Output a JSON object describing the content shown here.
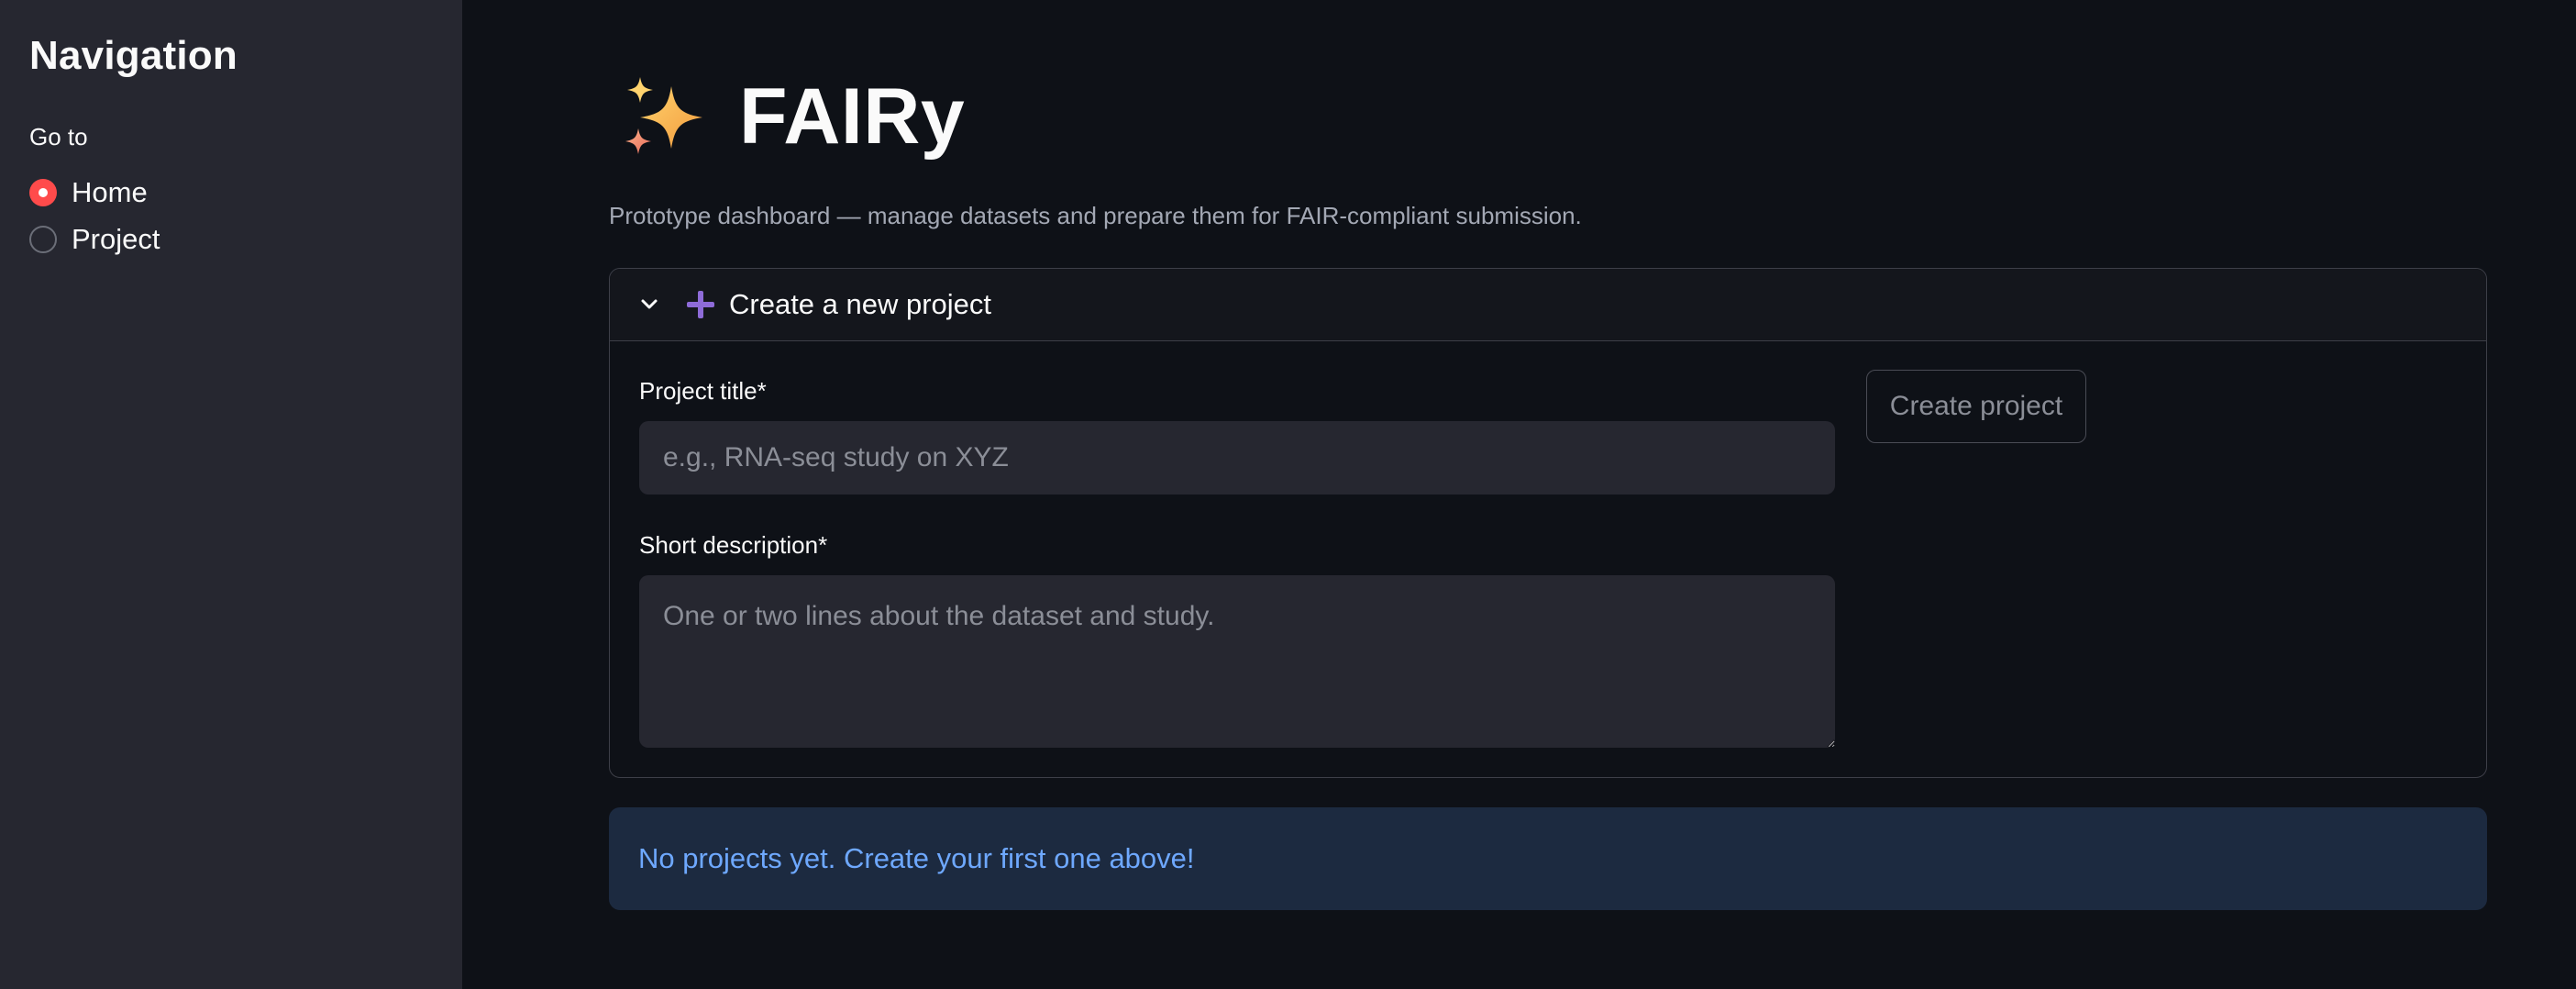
{
  "sidebar": {
    "title": "Navigation",
    "radio_label": "Go to",
    "options": [
      {
        "label": "Home",
        "selected": true
      },
      {
        "label": "Project",
        "selected": false
      }
    ]
  },
  "header": {
    "icon": "sparkles-icon",
    "title": "FAIRy",
    "subtitle": "Prototype dashboard — manage datasets and prepare them for FAIR-compliant submission."
  },
  "expander": {
    "label": "Create a new project",
    "expanded": true,
    "icon": "plus-icon",
    "title_field": {
      "label": "Project title*",
      "value": "",
      "placeholder": "e.g., RNA-seq study on XYZ"
    },
    "description_field": {
      "label": "Short description*",
      "value": "",
      "placeholder": "One or two lines about the dataset and study."
    },
    "create_button": "Create project"
  },
  "info": {
    "message": "No projects yet. Create your first one above!"
  },
  "colors": {
    "background": "#0e1117",
    "sidebar": "#262730",
    "accent_radio": "#ff4b4b",
    "info_background": "#1c2a40",
    "info_text": "#6ea8fe",
    "plus_icon": "#8e6bd8"
  }
}
